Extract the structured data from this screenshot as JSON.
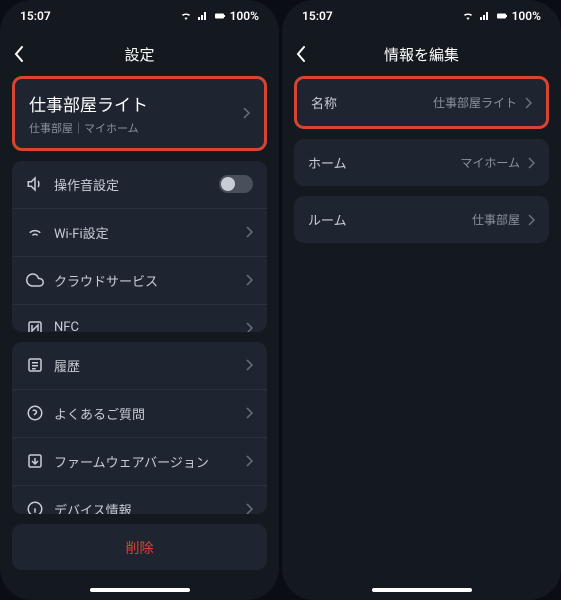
{
  "statusBar": {
    "time": "15:07",
    "battery": "100%"
  },
  "left": {
    "title": "設定",
    "device": {
      "name": "仕事部屋ライト",
      "location": "仕事部屋｜マイホーム"
    },
    "group1": [
      {
        "icon": "volume",
        "label": "操作音設定",
        "toggle": true
      },
      {
        "icon": "wifi",
        "label": "Wi-Fi設定",
        "chevron": true
      },
      {
        "icon": "cloud",
        "label": "クラウドサービス",
        "chevron": true
      },
      {
        "icon": "nfc",
        "label": "NFC",
        "chevron": true
      }
    ],
    "group2": [
      {
        "icon": "history",
        "label": "履歴",
        "chevron": true
      },
      {
        "icon": "help",
        "label": "よくあるご質問",
        "chevron": true
      },
      {
        "icon": "firmware",
        "label": "ファームウェアバージョン",
        "chevron": true
      },
      {
        "icon": "info",
        "label": "デバイス情報",
        "chevron": true
      }
    ],
    "deleteLabel": "削除"
  },
  "right": {
    "title": "情報を編集",
    "rows": [
      {
        "label": "名称",
        "value": "仕事部屋ライト",
        "highlighted": true
      },
      {
        "label": "ホーム",
        "value": "マイホーム"
      },
      {
        "label": "ルーム",
        "value": "仕事部屋"
      }
    ]
  }
}
